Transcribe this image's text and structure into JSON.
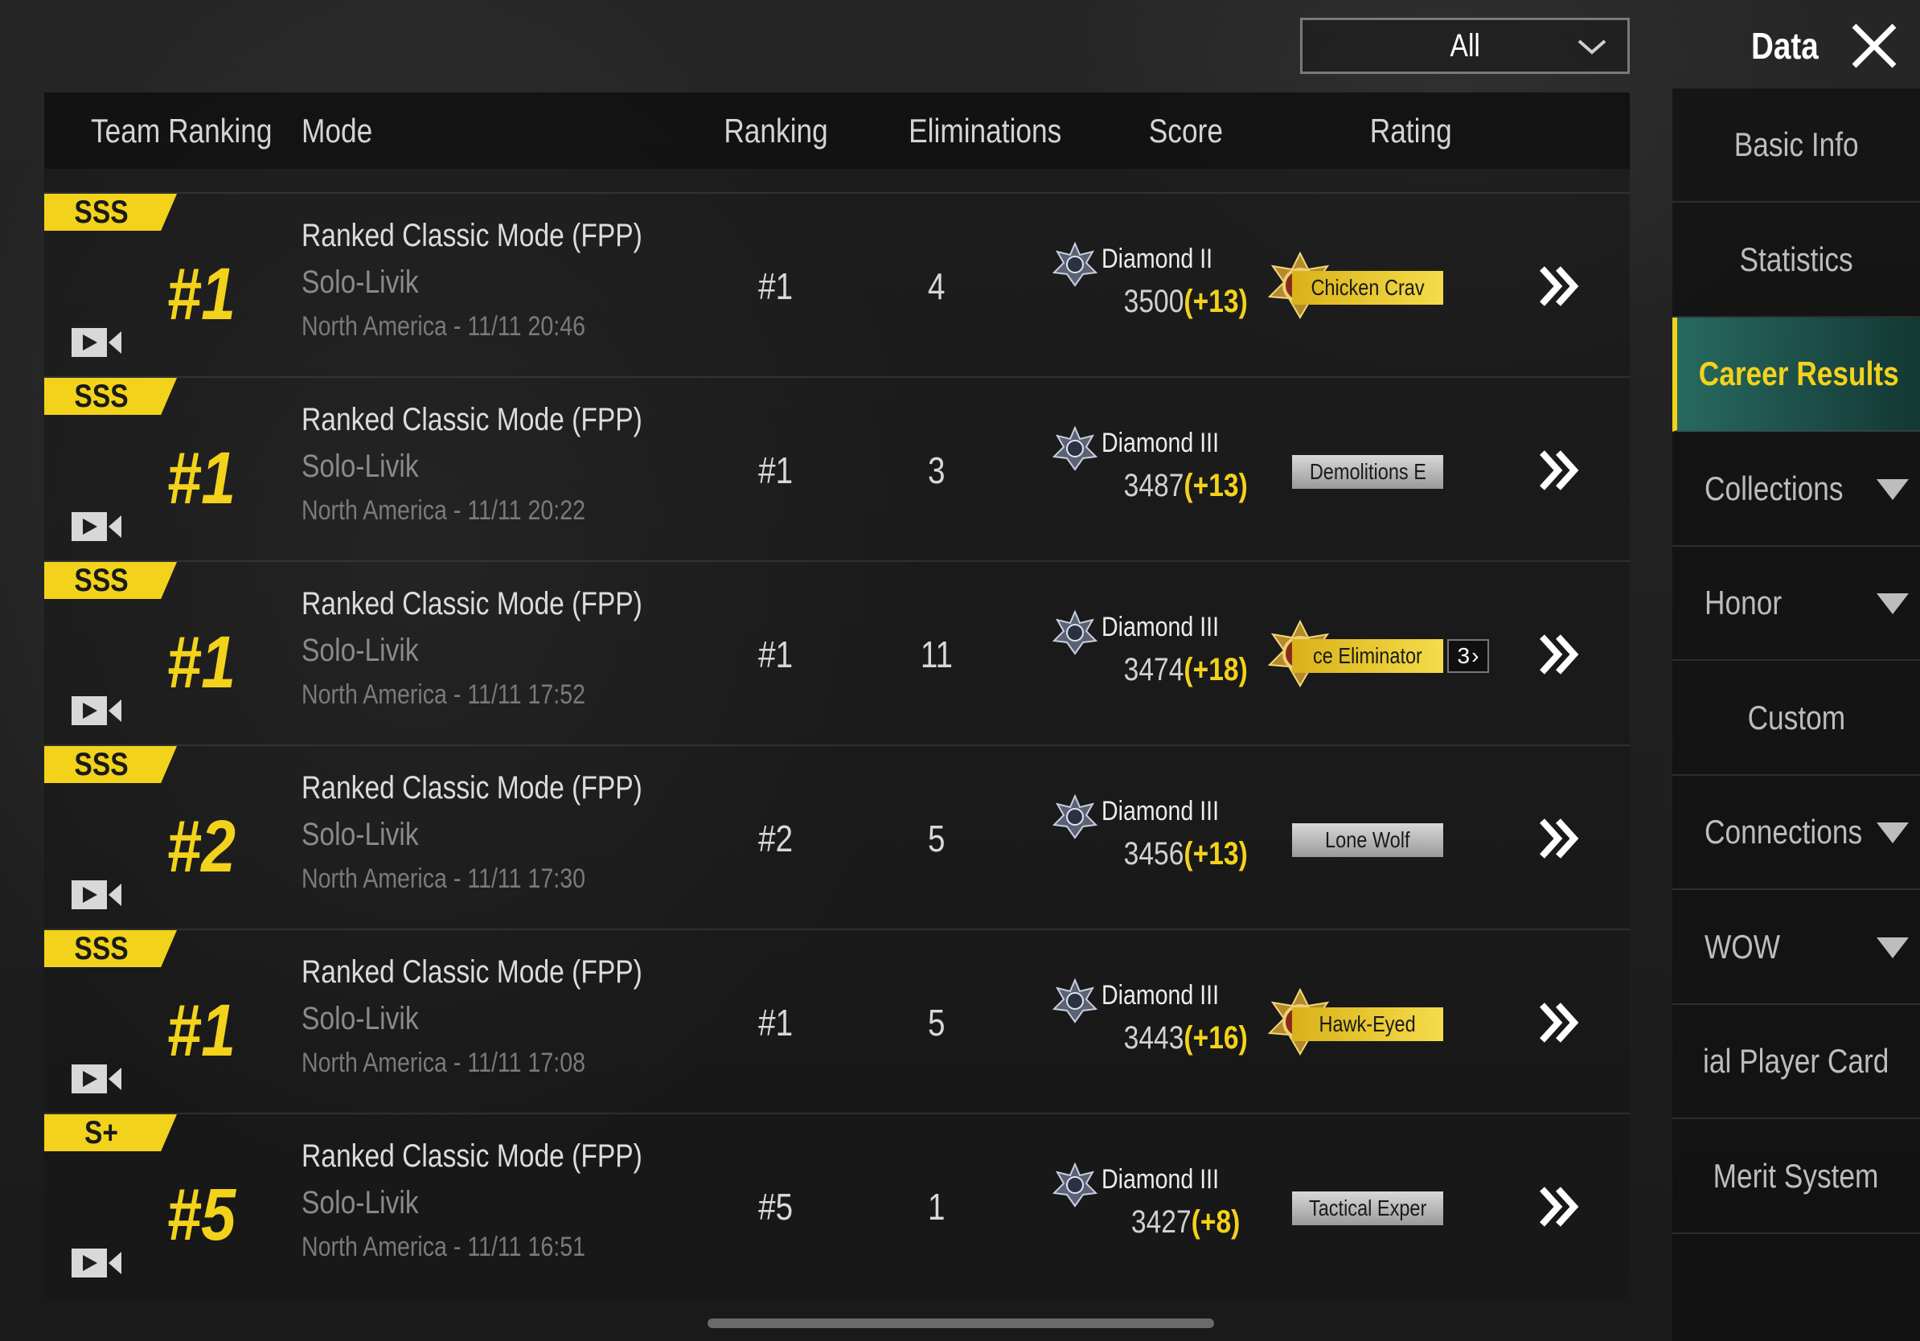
{
  "header": {
    "filter_value": "All",
    "title": "Data"
  },
  "table": {
    "columns": {
      "team_ranking": "Team Ranking",
      "mode": "Mode",
      "ranking": "Ranking",
      "eliminations": "Eliminations",
      "score": "Score",
      "rating": "Rating"
    },
    "rows": [
      {
        "tier": "SSS",
        "place": "#1",
        "mode": "Ranked Classic Mode (FPP)",
        "map": "Solo-Livik",
        "meta": "North America - 11/11 20:46",
        "ranking": "#1",
        "eliminations": "4",
        "rank_tier": "Diamond II",
        "score": "3500",
        "delta": "(+13)",
        "rating": "Chicken Crav",
        "rating_style": "gold",
        "count": ""
      },
      {
        "tier": "SSS",
        "place": "#1",
        "mode": "Ranked Classic Mode (FPP)",
        "map": "Solo-Livik",
        "meta": "North America - 11/11 20:22",
        "ranking": "#1",
        "eliminations": "3",
        "rank_tier": "Diamond III",
        "score": "3487",
        "delta": "(+13)",
        "rating": "Demolitions E",
        "rating_style": "silver",
        "count": ""
      },
      {
        "tier": "SSS",
        "place": "#1",
        "mode": "Ranked Classic Mode (FPP)",
        "map": "Solo-Livik",
        "meta": "North America - 11/11 17:52",
        "ranking": "#1",
        "eliminations": "11",
        "rank_tier": "Diamond III",
        "score": "3474",
        "delta": "(+18)",
        "rating": "ce Eliminator",
        "rating_style": "gold",
        "count": "3"
      },
      {
        "tier": "SSS",
        "place": "#2",
        "mode": "Ranked Classic Mode (FPP)",
        "map": "Solo-Livik",
        "meta": "North America - 11/11 17:30",
        "ranking": "#2",
        "eliminations": "5",
        "rank_tier": "Diamond III",
        "score": "3456",
        "delta": "(+13)",
        "rating": "Lone Wolf",
        "rating_style": "silver",
        "count": ""
      },
      {
        "tier": "SSS",
        "place": "#1",
        "mode": "Ranked Classic Mode (FPP)",
        "map": "Solo-Livik",
        "meta": "North America - 11/11 17:08",
        "ranking": "#1",
        "eliminations": "5",
        "rank_tier": "Diamond III",
        "score": "3443",
        "delta": "(+16)",
        "rating": "Hawk-Eyed",
        "rating_style": "gold",
        "count": ""
      },
      {
        "tier": "S+",
        "place": "#5",
        "mode": "Ranked Classic Mode (FPP)",
        "map": "Solo-Livik",
        "meta": "North America - 11/11 16:51",
        "ranking": "#5",
        "eliminations": "1",
        "rank_tier": "Diamond III",
        "score": "3427",
        "delta": "(+8)",
        "rating": "Tactical Exper",
        "rating_style": "silver",
        "count": ""
      }
    ]
  },
  "sidebar": {
    "items": [
      {
        "label": "Basic Info",
        "active": false,
        "caret": false
      },
      {
        "label": "Statistics",
        "active": false,
        "caret": false
      },
      {
        "label": "Career Results",
        "active": true,
        "caret": false
      },
      {
        "label": "Collections",
        "active": false,
        "caret": true
      },
      {
        "label": "Honor",
        "active": false,
        "caret": true
      },
      {
        "label": "Custom",
        "active": false,
        "caret": false
      },
      {
        "label": "Connections",
        "active": false,
        "caret": true
      },
      {
        "label": "WOW",
        "active": false,
        "caret": true
      },
      {
        "label": "ial Player Card",
        "active": false,
        "caret": false
      },
      {
        "label": "Merit System",
        "active": false,
        "caret": false
      }
    ]
  },
  "colors": {
    "accent_yellow": "#f2d21b",
    "active_teal": "#286e64"
  },
  "icons": {
    "filter_chevron": "chevron-down-icon",
    "close": "close-icon",
    "video": "video-replay-icon",
    "rank_badge": "diamond-rank-icon",
    "medal": "medal-icon",
    "row_go": "double-chevron-right-icon"
  }
}
